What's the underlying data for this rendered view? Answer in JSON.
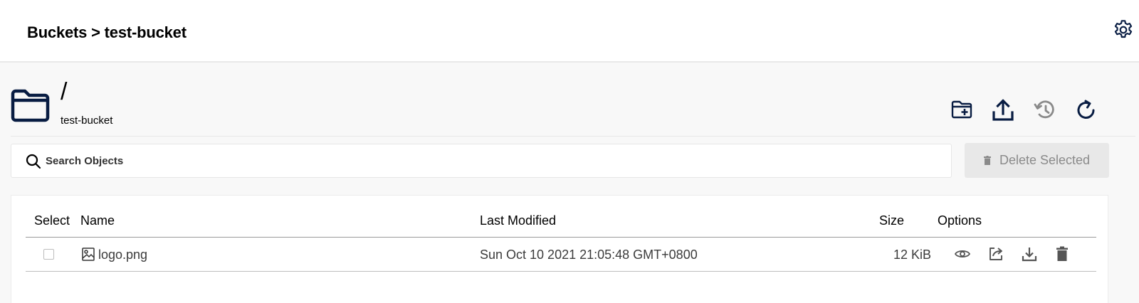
{
  "topbar": {
    "breadcrumb": "Buckets > test-bucket",
    "settings_icon": "gear-icon"
  },
  "header": {
    "path": "/",
    "bucket_name": "test-bucket",
    "folder_icon": "folder-icon",
    "actions": [
      {
        "name": "create-folder-button",
        "icon": "folder-plus-icon",
        "disabled": false
      },
      {
        "name": "upload-button",
        "icon": "upload-icon",
        "disabled": false
      },
      {
        "name": "rewind-button",
        "icon": "history-icon",
        "disabled": true
      },
      {
        "name": "refresh-button",
        "icon": "refresh-icon",
        "disabled": false
      }
    ]
  },
  "search": {
    "placeholder": "Search Objects",
    "value": ""
  },
  "delete_selected": {
    "label": "Delete Selected",
    "disabled": true
  },
  "table": {
    "columns": [
      "Select",
      "Name",
      "Last Modified",
      "Size",
      "Options"
    ],
    "rows": [
      {
        "selected": false,
        "name": "logo.png",
        "type_icon": "image-file-icon",
        "last_modified": "Sun Oct 10 2021 21:05:48 GMT+0800",
        "size": "12 KiB",
        "options": [
          "preview-icon",
          "share-icon",
          "download-icon",
          "delete-icon"
        ]
      }
    ]
  },
  "colors": {
    "icon_dark": "#081c42",
    "icon_disabled": "#8a8a8a",
    "text_row": "#3b3b3b",
    "delete_bg": "#e8e8e8"
  }
}
